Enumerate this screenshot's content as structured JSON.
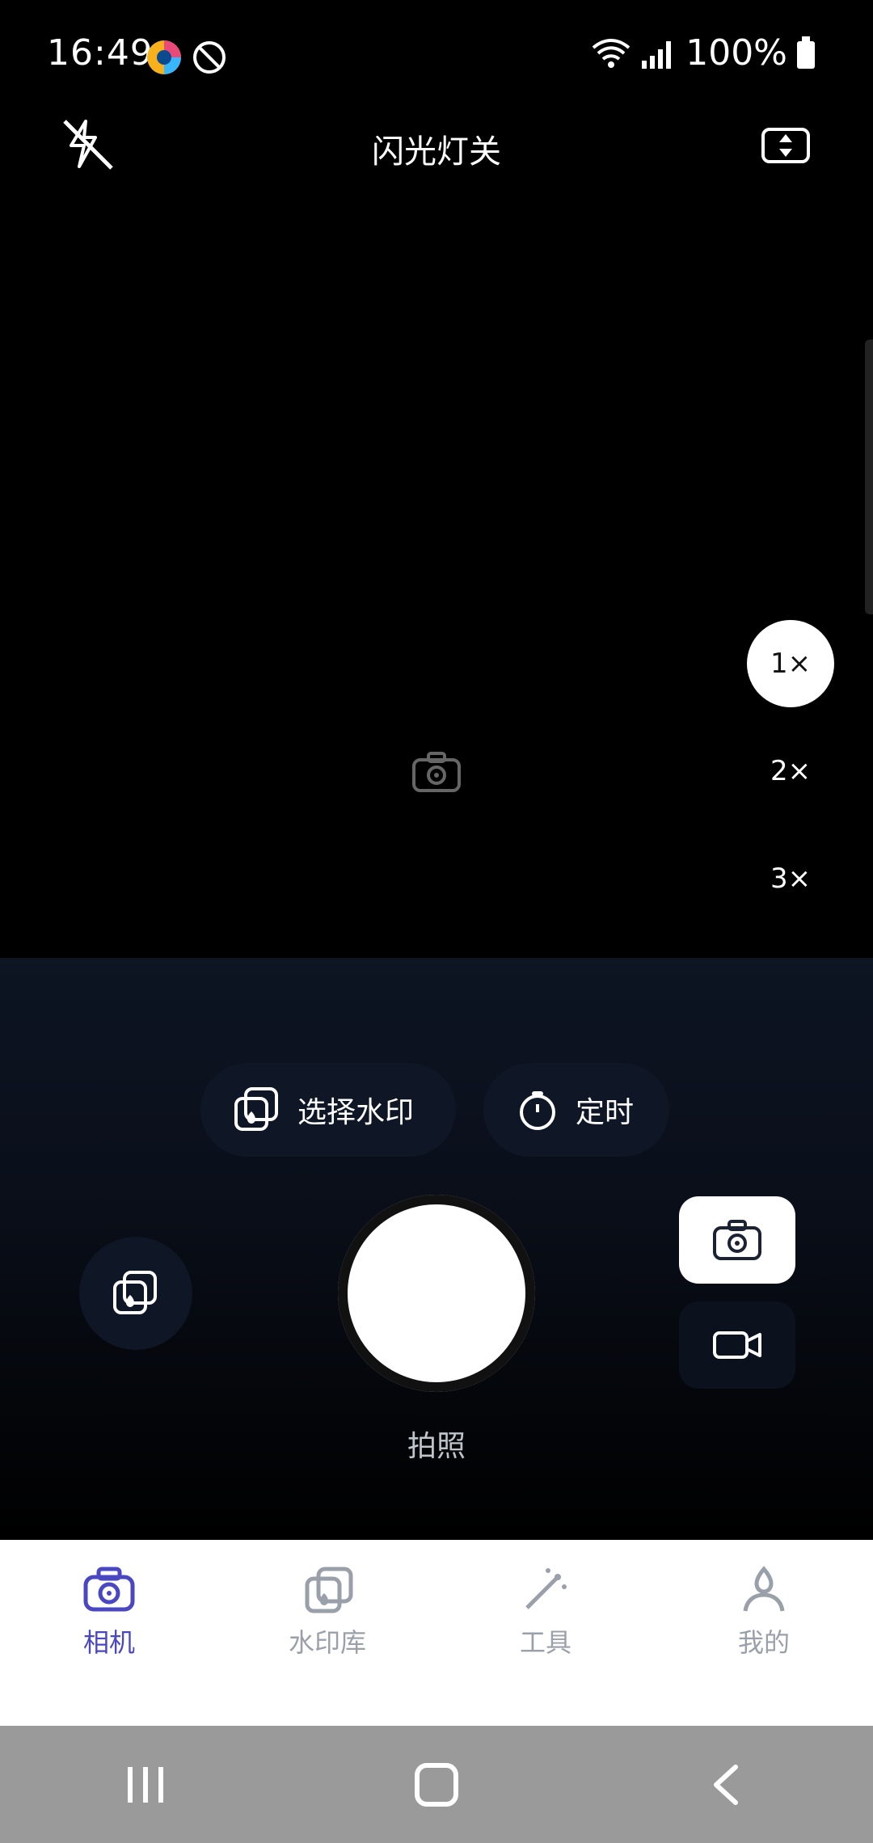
{
  "status_bar": {
    "time": "16:49",
    "battery": "100%"
  },
  "top": {
    "flash_label": "闪光灯关"
  },
  "zoom": [
    "1×",
    "2×",
    "3×"
  ],
  "actions": {
    "select_watermark": "选择水印",
    "timer": "定时"
  },
  "shutter": {
    "label": "拍照"
  },
  "tabs": [
    {
      "label": "相机",
      "active": true
    },
    {
      "label": "水印库",
      "active": false
    },
    {
      "label": "工具",
      "active": false
    },
    {
      "label": "我的",
      "active": false
    }
  ],
  "colors": {
    "accent": "#4a47c2",
    "tab_inactive": "#9aa0aa"
  }
}
